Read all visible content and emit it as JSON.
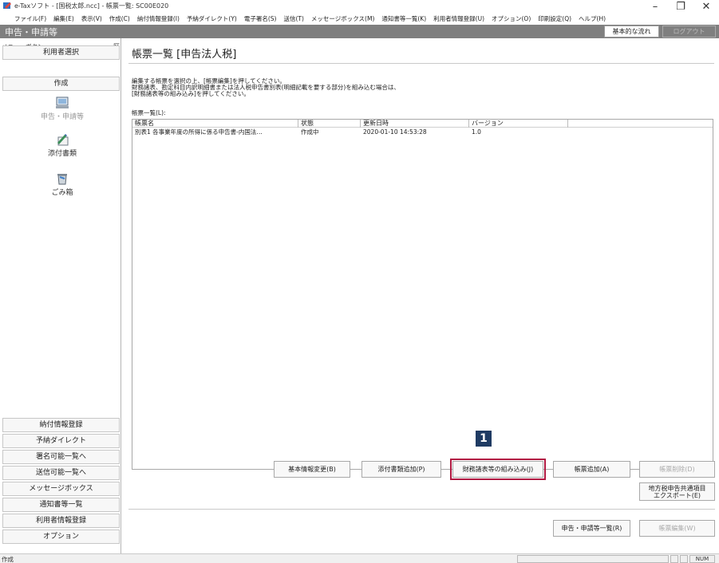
{
  "window": {
    "title": "e-Taxソフト - [国税太郎.ncc] - 帳票一覧: SC00E020",
    "minimize_icon": "–",
    "maximize_icon": "❐",
    "close_icon": "✕"
  },
  "menu": [
    "ファイル(F)",
    "編集(E)",
    "表示(V)",
    "作成(C)",
    "納付情報登録(I)",
    "予納ダイレクト(Y)",
    "電子署名(S)",
    "送信(T)",
    "メッセージボックス(M)",
    "通知書等一覧(K)",
    "利用者情報登録(U)",
    "オプション(O)",
    "印刷設定(Q)",
    "ヘルプ(H)"
  ],
  "header": {
    "section_title": "申告・申請等",
    "basic_flow_button": "基本的な流れ",
    "logout_button": "ログアウト"
  },
  "sidebar": {
    "menu_label": "メニューボタン",
    "close_glyph": "区",
    "top_buttons": [
      "利用者選択",
      "作成"
    ],
    "tools": [
      {
        "label": "申告・申請等",
        "icon": "computer-icon",
        "muted": true
      },
      {
        "label": "添付書類",
        "icon": "attachment-icon",
        "muted": false
      },
      {
        "label": "ごみ箱",
        "icon": "trash-icon",
        "muted": false
      }
    ],
    "bottom_buttons": [
      "納付情報登録",
      "予納ダイレクト",
      "署名可能一覧へ",
      "送信可能一覧へ",
      "メッセージボックス",
      "通知書等一覧",
      "利用者情報登録",
      "オプション"
    ]
  },
  "main": {
    "title": "帳票一覧 [申告法人税]",
    "instructions": [
      "編集する帳票を選択の上、[帳票編集]を押してください。",
      "財務諸表、勘定科目内訳明細書または法人税申告書別表(明細記載を要する部分)を組み込む場合は、",
      "[財務諸表等の組み込み]を押してください。"
    ],
    "list_label": "帳票一覧(L):",
    "columns": [
      "帳票名",
      "状態",
      "更新日時",
      "バージョン"
    ],
    "rows": [
      {
        "name": "別表1 各事業年度の所得に係る申告書-内国法…",
        "status": "作成中",
        "updated": "2020-01-10 14:53:28",
        "version": "1.0"
      }
    ],
    "buttons": {
      "basic_info": "基本情報変更(B)",
      "add_attachment": "添付書類追加(P)",
      "incorporate_financial": "財務諸表等の組み込み(J)",
      "add_form": "帳票追加(A)",
      "delete_form": "帳票削除(D)",
      "export_local": [
        "地方税申告共通項目",
        "エクスポート(E)"
      ],
      "application_list": "申告・申請等一覧(R)",
      "edit_form": "帳票編集(W)"
    },
    "step_badge": "1"
  },
  "status": {
    "text": "作成",
    "num_label": "NUM"
  },
  "colors": {
    "section_bar": "#7f7f7f",
    "highlight": "#b11a42",
    "badge": "#1f3b63"
  }
}
